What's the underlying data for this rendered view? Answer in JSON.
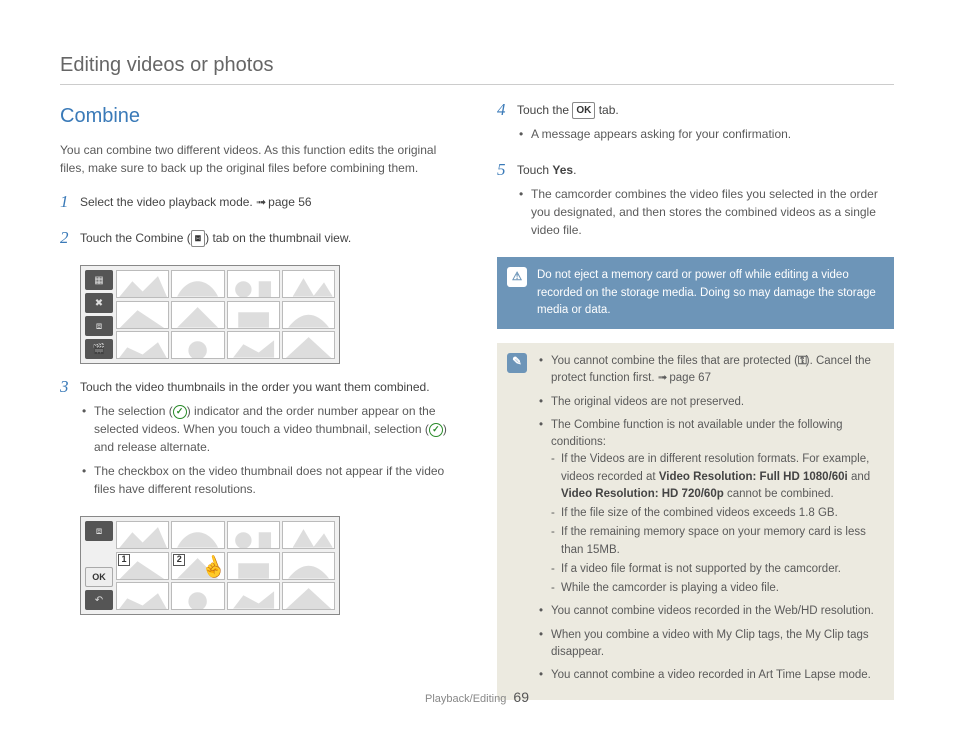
{
  "header": "Editing videos or photos",
  "section_title": "Combine",
  "intro": "You can combine two different videos. As this function edits the original files, make sure to back up the original files before combining them.",
  "steps": {
    "s1": {
      "text": "Select the video playback mode. ",
      "ref": "page 56"
    },
    "s2": {
      "pre": "Touch the Combine (",
      "post": ") tab on the thumbnail view."
    },
    "s3": {
      "text": "Touch the video thumbnails in the order you want them combined.",
      "b1_pre": "The selection (",
      "b1_mid": ") indicator and the order number appear on the selected videos. When you touch a video thumbnail, selection (",
      "b1_post": ") and release alternate.",
      "b2": "The checkbox on the video thumbnail does not appear if the video files have different resolutions."
    },
    "s4": {
      "pre": "Touch the ",
      "post": " tab.",
      "ok": "OK",
      "b1": "A message appears asking for your confirmation."
    },
    "s5": {
      "pre": "Touch ",
      "bold": "Yes",
      "post": ".",
      "b1": "The camcorder combines the video files you selected in the order you designated, and then stores the combined videos as a single video file."
    }
  },
  "warn": "Do not eject a memory card or power off while editing a video recorded on the storage media. Doing so may damage the storage media or data.",
  "notes": {
    "n1_pre": "You cannot combine the files that are protected (",
    "n1_post": "). Cancel the protect function first. ",
    "n1_ref": "page 67",
    "n2": "The original videos are not preserved.",
    "n3": "The Combine function is not available under the following conditions:",
    "n3a_pre": "If the Videos are in different resolution formats. For example, videos recorded at ",
    "n3a_b1": "Video Resolution: Full HD 1080/60i",
    "n3a_mid": " and ",
    "n3a_b2": "Video Resolution: HD 720/60p",
    "n3a_post": " cannot be combined.",
    "n3b": "If the file size of the combined videos exceeds 1.8 GB.",
    "n3c": "If the remaining memory space on your memory card is less than 15MB.",
    "n3d": "If a video file format is not supported by the camcorder.",
    "n3e": "While the camcorder is playing a video file.",
    "n4": "You cannot combine videos recorded in the Web/HD resolution.",
    "n5": "When you combine a video with My Clip tags, the My Clip tags disappear.",
    "n6": "You cannot combine a video recorded in Art Time Lapse mode."
  },
  "thumb2": {
    "badge1": "1",
    "badge2": "2",
    "ok": "OK"
  },
  "footer": {
    "section": "Playback/Editing",
    "page": "69"
  }
}
